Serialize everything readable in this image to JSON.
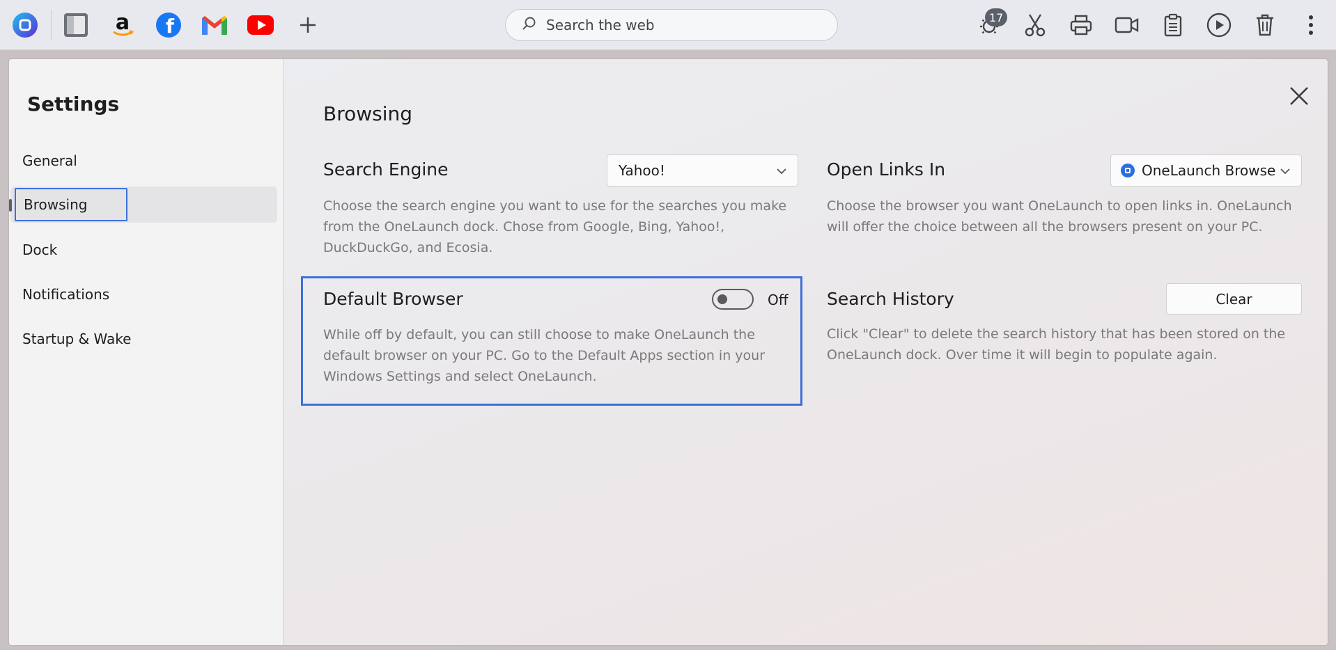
{
  "dock": {
    "icons": [
      "onelaunch-icon",
      "files-icon",
      "amazon-icon",
      "facebook-icon",
      "gmail-icon",
      "youtube-icon",
      "add-icon"
    ],
    "search_placeholder": "Search the web",
    "weather_badge": "17",
    "tools": [
      "weather-icon",
      "scissors-icon",
      "printer-icon",
      "video-icon",
      "clipboard-icon",
      "play-icon",
      "trash-icon",
      "more-icon"
    ]
  },
  "sidebar": {
    "title": "Settings",
    "items": [
      {
        "label": "General"
      },
      {
        "label": "Browsing"
      },
      {
        "label": "Dock"
      },
      {
        "label": "Notifications"
      },
      {
        "label": "Startup & Wake"
      }
    ]
  },
  "main": {
    "section_title": "Browsing",
    "search_engine": {
      "title": "Search Engine",
      "value": "Yahoo!",
      "description_lines": [
        "Choose the search engine you want to use for the searches you make",
        "from the OneLaunch dock. Chose from Google, Bing, Yahoo!,",
        "DuckDuckGo, and Ecosia."
      ]
    },
    "open_links": {
      "title": "Open Links In",
      "value": "OneLaunch Browse",
      "description_lines": [
        "Choose the browser you want OneLaunch to open links in. OneLaunch",
        "will offer the choice between all the browsers present on your PC."
      ]
    },
    "default_browser": {
      "title": "Default Browser",
      "toggle_label": "Off",
      "toggle_on": false,
      "description_lines": [
        "While off by default, you can still choose to make OneLaunch the",
        "default browser on your PC. Go to the Default Apps section in your",
        "Windows Settings and select OneLaunch."
      ]
    },
    "search_history": {
      "title": "Search History",
      "button_label": "Clear",
      "description_lines": [
        "Click \"Clear\" to delete the search history that has been stored on the",
        "OneLaunch dock. Over time it will begin to populate again."
      ]
    }
  },
  "colors": {
    "focus": "#3d6fd8",
    "facebook": "#1877f2",
    "youtube": "#ff0000",
    "onelaunch": "#2a6fe0"
  }
}
